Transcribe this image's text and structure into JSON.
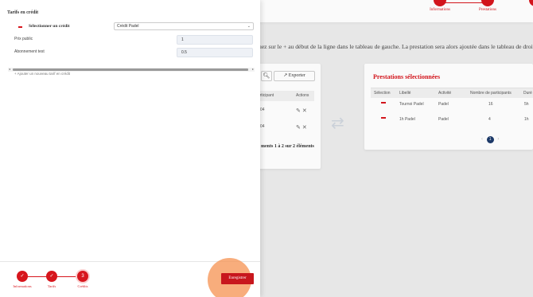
{
  "background": {
    "top_steps": [
      {
        "label": "Informations"
      },
      {
        "label": "Prestations"
      },
      {
        "label": "Cr"
      }
    ],
    "instruction": "liquez sur le + au début de la ligne dans le tableau de gauche. La prestation sera alors ajoutée dans le tableau de droite. Vo",
    "left_card": {
      "export_label": "Exporter",
      "headers": [
        "r participant",
        "Actions"
      ],
      "rows": [
        {
          "value": "04"
        },
        {
          "value": "04"
        }
      ],
      "footer": "ments 1 à 2 sur 2 éléments"
    },
    "right_card": {
      "title": "Prestations sélectionnées",
      "headers": [
        "Sélection",
        "Libellé",
        "Activité",
        "Nombre de participants",
        "Duré"
      ],
      "rows": [
        {
          "libelle": "Tournoi Padel",
          "activite": "Padel",
          "participants": "16",
          "duree": "5h"
        },
        {
          "libelle": "1h Padel",
          "activite": "Padel",
          "participants": "4",
          "duree": "1h"
        }
      ],
      "pager": {
        "prev": "‹",
        "current": "1",
        "next": "›"
      }
    }
  },
  "panel": {
    "title": "Tarifs en crédit",
    "select_label": "Sélectionner un crédit",
    "select_value": "Crédit Padel",
    "fields": [
      {
        "label": "Prix public",
        "value": "1"
      },
      {
        "label": "Abonnement test",
        "value": "0.5"
      }
    ],
    "add_link": "Ajouter un nouveau tarif en crédit",
    "wizard": [
      {
        "label": "Informations",
        "mark": "✓"
      },
      {
        "label": "Tarifs",
        "mark": "✓"
      },
      {
        "label": "Crédits",
        "mark": "3"
      }
    ],
    "save_label": "Enregistrer"
  },
  "colors": {
    "accent": "#d7161d",
    "highlight": "#f59150",
    "pager": "#1d3b6b"
  }
}
